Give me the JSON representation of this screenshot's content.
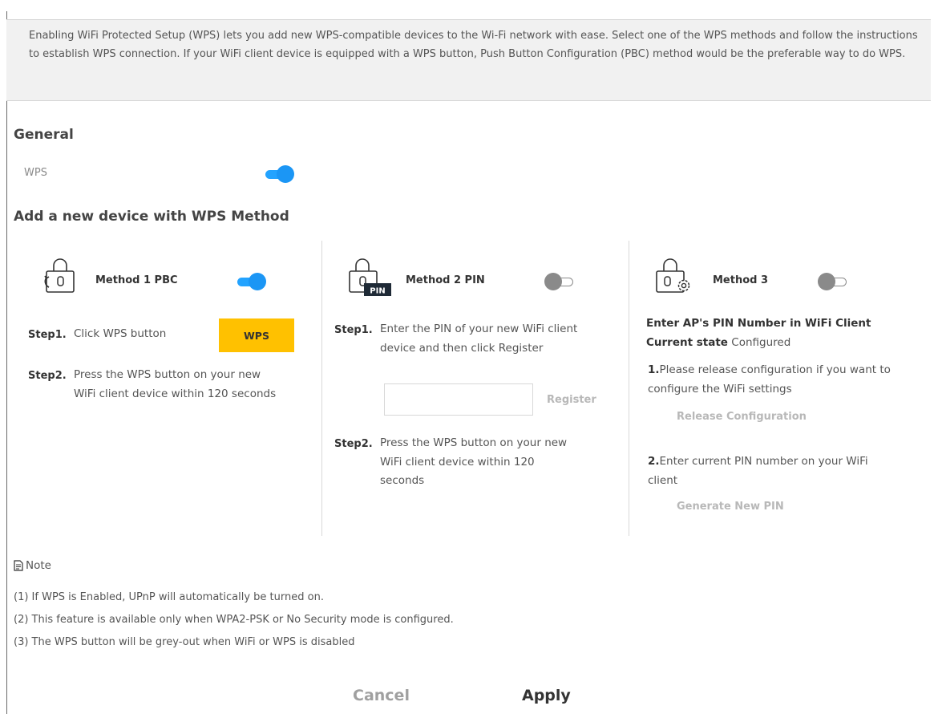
{
  "intro": "Enabling WiFi Protected Setup (WPS) lets you add new WPS-compatible devices to the Wi-Fi network with ease. Select one of the WPS methods and follow the instructions to establish WPS connection. If your WiFi client device is equipped with a WPS button, Push Button Configuration (PBC) method would be the preferable way to do WPS.",
  "general": {
    "title": "General",
    "wps_label": "WPS",
    "wps_enabled": true
  },
  "add_device": {
    "title": "Add a new device with WPS Method"
  },
  "method1": {
    "title": "Method 1 PBC",
    "enabled": true,
    "step1_key": "Step1.",
    "step1_text": "Click WPS button",
    "wps_button": "WPS",
    "step2_key": "Step2.",
    "step2_text": "Press the WPS button on your new WiFi client device within 120 seconds"
  },
  "method2": {
    "title": "Method 2 PIN",
    "enabled": false,
    "pin_badge": "PIN",
    "step1_key": "Step1.",
    "step1_text": "Enter the PIN of your new WiFi client device and then click Register",
    "pin_value": "",
    "register_button": "Register",
    "step2_key": "Step2.",
    "step2_text": "Press the WPS button on your new WiFi client device within 120 seconds"
  },
  "method3": {
    "title": "Method 3",
    "enabled": false,
    "heading": "Enter AP's PIN Number in WiFi Client",
    "state_label": "Current state",
    "state_value": "Configured",
    "item1_num": "1.",
    "item1_text": "Please release configuration if you want to configure the WiFi settings",
    "release_button": "Release Configuration",
    "item2_num": "2.",
    "item2_text": "Enter current PIN number on your WiFi client",
    "generate_button": "Generate New PIN"
  },
  "note": {
    "title": "Note",
    "lines": [
      "(1) If WPS is Enabled, UPnP will automatically be turned on.",
      "(2) This feature is available only when WPA2-PSK or No Security mode is configured.",
      "(3) The WPS button will be grey-out when WiFi or WPS is disabled"
    ]
  },
  "footer": {
    "cancel": "Cancel",
    "apply": "Apply"
  },
  "colors": {
    "toggle_on": "#1b96f5",
    "toggle_off": "#8a8a8a",
    "accent": "#ffc100"
  }
}
